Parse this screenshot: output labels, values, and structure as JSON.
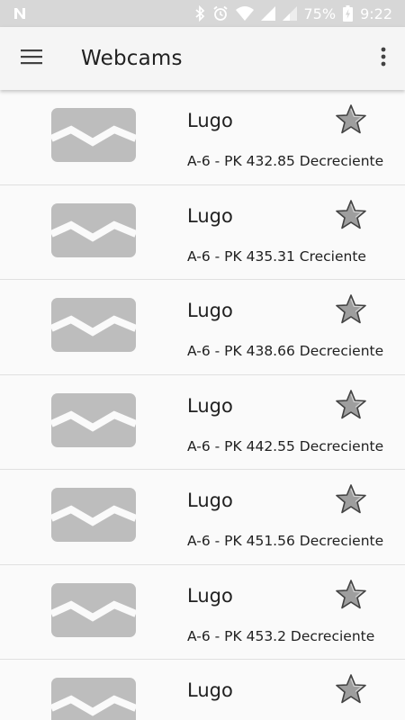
{
  "status_bar": {
    "battery": "75%",
    "time": "9:22"
  },
  "app_bar": {
    "title": "Webcams",
    "menu_icon": "hamburger-menu-icon",
    "overflow_icon": "more-vert-icon"
  },
  "webcams": [
    {
      "title": "Lugo",
      "subtitle": "A-6 - PK 432.85 Decreciente"
    },
    {
      "title": "Lugo",
      "subtitle": "A-6 - PK 435.31 Creciente"
    },
    {
      "title": "Lugo",
      "subtitle": "A-6 - PK 438.66 Decreciente"
    },
    {
      "title": "Lugo",
      "subtitle": "A-6 - PK 442.55 Decreciente"
    },
    {
      "title": "Lugo",
      "subtitle": "A-6 - PK 451.56 Decreciente"
    },
    {
      "title": "Lugo",
      "subtitle": "A-6 - PK 453.2 Decreciente"
    },
    {
      "title": "Lugo",
      "subtitle": ""
    }
  ],
  "colors": {
    "status_bar": "#d7d7d7",
    "app_bar": "#f5f5f5",
    "placeholder": "#bdbdbd",
    "star": "#9e9e9e"
  }
}
